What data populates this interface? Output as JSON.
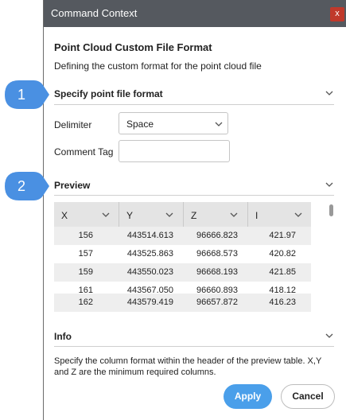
{
  "window": {
    "title": "Command Context",
    "close_glyph": "x",
    "close_icon": "close-icon"
  },
  "heading": "Point Cloud Custom File Format",
  "subheading": "Defining the custom format for the point cloud file",
  "sections": {
    "format": {
      "title": "Specify point file format",
      "chevron_icon": "chevron-down-icon"
    },
    "preview": {
      "title": "Preview",
      "chevron_icon": "chevron-down-icon"
    },
    "info": {
      "title": "Info",
      "chevron_icon": "chevron-down-icon"
    }
  },
  "fields": {
    "delimiter_label": "Delimiter",
    "delimiter_value": "Space",
    "comment_tag_label": "Comment Tag",
    "comment_tag_value": ""
  },
  "preview_table": {
    "columns": [
      "X",
      "Y",
      "Z",
      "I"
    ],
    "rows": [
      [
        "156",
        "443514.613",
        "96666.823",
        "421.97"
      ],
      [
        "157",
        "443525.863",
        "96668.573",
        "420.82"
      ],
      [
        "159",
        "443550.023",
        "96668.193",
        "421.85"
      ],
      [
        "161",
        "443567.050",
        "96660.893",
        "418.12"
      ],
      [
        "162",
        "443579.419",
        "96657.872",
        "416.23"
      ]
    ]
  },
  "info_text": "Specify the column format within the header of the preview table. X,Y and Z are the minimum required columns.",
  "buttons": {
    "apply": "Apply",
    "cancel": "Cancel"
  },
  "callouts": [
    "1",
    "2"
  ],
  "colors": {
    "titlebar": "#55595f",
    "close": "#c0392b",
    "apply": "#4a9fea",
    "callout": "#4a90e2",
    "table_header": "#e4e4e4"
  }
}
